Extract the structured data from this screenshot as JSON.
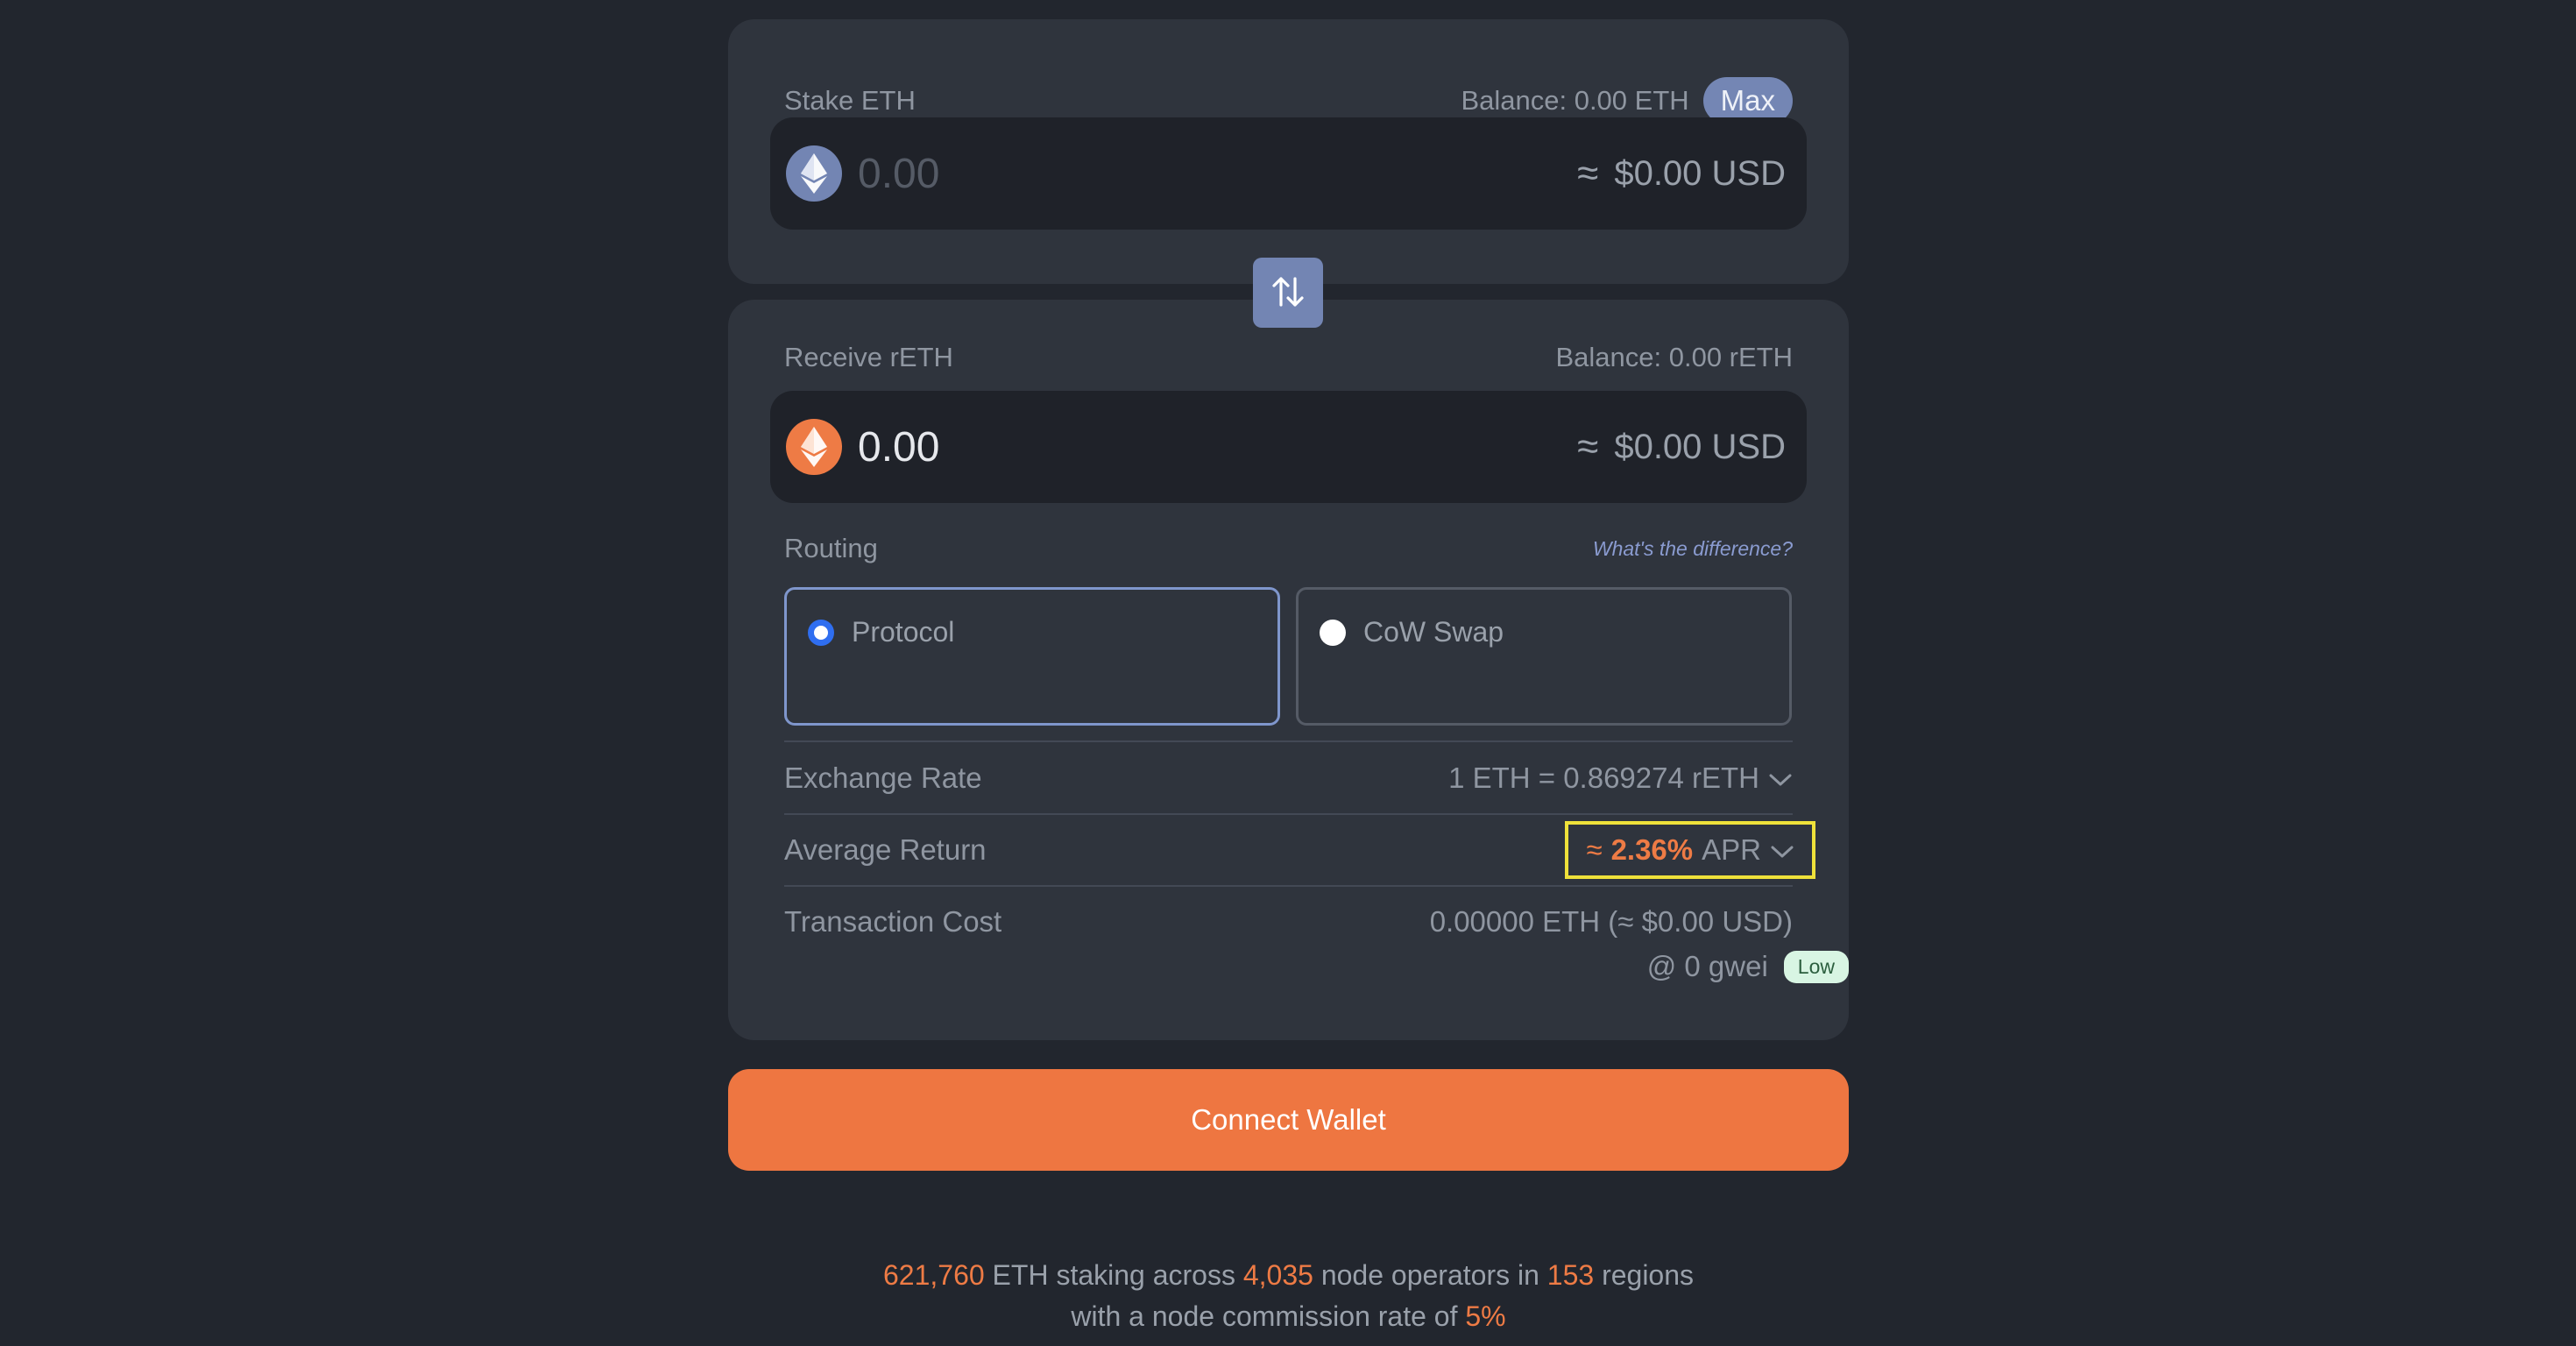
{
  "stake": {
    "label": "Stake ETH",
    "balance": "Balance: 0.00 ETH",
    "max_label": "Max",
    "amount_placeholder": "0.00",
    "approx": "≈",
    "usd": "$0.00 USD"
  },
  "receive": {
    "label": "Receive rETH",
    "balance": "Balance: 0.00 rETH",
    "amount": "0.00",
    "approx": "≈",
    "usd": "$0.00 USD"
  },
  "routing": {
    "label": "Routing",
    "help_link": "What's the difference?",
    "options": [
      {
        "label": "Protocol",
        "selected": true
      },
      {
        "label": "CoW Swap",
        "selected": false
      }
    ]
  },
  "details": {
    "exchange_rate_label": "Exchange Rate",
    "exchange_rate_value": "1 ETH = 0.869274 rETH",
    "average_return_label": "Average Return",
    "apr_approx": "≈",
    "apr_value": "2.36%",
    "apr_unit": "APR",
    "tx_cost_label": "Transaction Cost",
    "tx_cost_value": "0.00000 ETH (≈ $0.00 USD)",
    "gas_price": "@ 0 gwei",
    "gas_level": "Low"
  },
  "connect_wallet": "Connect Wallet",
  "stats": {
    "eth_staked": "621,760",
    "t1": "ETH staking across",
    "node_operators": "4,035",
    "t2": "node operators in",
    "regions": "153",
    "t3": "regions",
    "t4": "with a node commission rate of",
    "commission": "5%"
  },
  "colors": {
    "background": "#22262e",
    "card": "#2f343d",
    "accent_orange": "#ee7641",
    "accent_blue": "#7385b3",
    "highlight_box": "#efe13a"
  }
}
